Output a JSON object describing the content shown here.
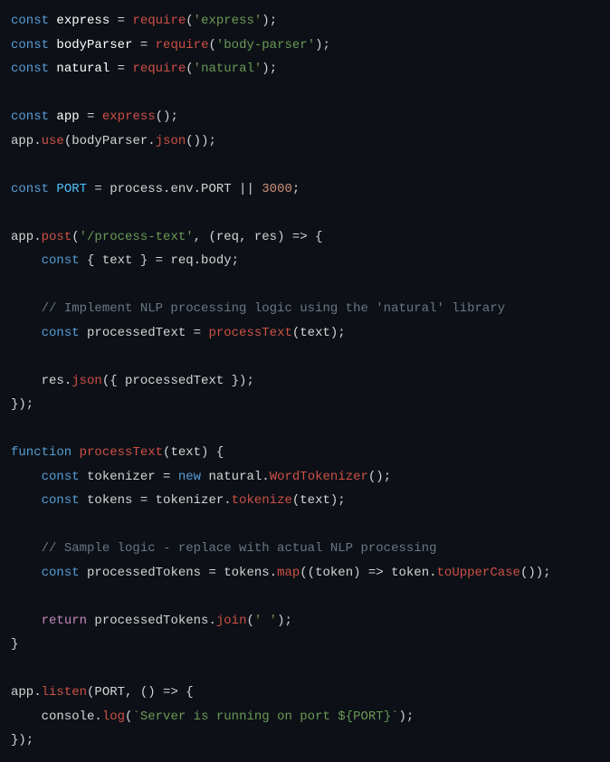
{
  "code": {
    "l1_const": "const",
    "l1_express": "express",
    "l1_eq": " = ",
    "l1_require": "require",
    "l1_open": "(",
    "l1_str": "'express'",
    "l1_close": ");",
    "l2_const": "const",
    "l2_bodyParser": "bodyParser",
    "l2_eq": " = ",
    "l2_require": "require",
    "l2_open": "(",
    "l2_str": "'body-parser'",
    "l2_close": ");",
    "l3_const": "const",
    "l3_natural": "natural",
    "l3_eq": " = ",
    "l3_require": "require",
    "l3_open": "(",
    "l3_str": "'natural'",
    "l3_close": ");",
    "l5_const": "const",
    "l5_app": "app",
    "l5_eq": " = ",
    "l5_express": "express",
    "l5_call": "();",
    "l6_app": "app.",
    "l6_use": "use",
    "l6_open": "(bodyParser.",
    "l6_json": "json",
    "l6_close": "());",
    "l8_const": "const",
    "l8_port": "PORT",
    "l8_eq": " = process.env.PORT || ",
    "l8_num": "3000",
    "l8_semi": ";",
    "l10_app": "app.",
    "l10_post": "post",
    "l10_open": "(",
    "l10_str": "'/process-text'",
    "l10_arrow": ", (req, res) => {",
    "l11_indent": "    ",
    "l11_const": "const",
    "l11_dest": " { text } = req.body;",
    "l13_indent": "    ",
    "l13_comment": "// Implement NLP processing logic using the 'natural' library",
    "l14_indent": "    ",
    "l14_const": "const",
    "l14_pt": " processedText = ",
    "l14_fn": "processText",
    "l14_args": "(text);",
    "l16_indent": "    ",
    "l16_res": "res.",
    "l16_json": "json",
    "l16_args": "({ processedText });",
    "l17_close": "});",
    "l19_function": "function",
    "l19_name": "processText",
    "l19_params": "(text) {",
    "l20_indent": "    ",
    "l20_const": "const",
    "l20_tok": " tokenizer = ",
    "l20_new": "new",
    "l20_nat": " natural.",
    "l20_wt": "WordTokenizer",
    "l20_call": "();",
    "l21_indent": "    ",
    "l21_const": "const",
    "l21_tok": " tokens = tokenizer.",
    "l21_tokenize": "tokenize",
    "l21_args": "(text);",
    "l23_indent": "    ",
    "l23_comment": "// Sample logic - replace with actual NLP processing",
    "l24_indent": "    ",
    "l24_const": "const",
    "l24_pt": " processedTokens = tokens.",
    "l24_map": "map",
    "l24_arrow": "((token) => token.",
    "l24_upper": "toUpperCase",
    "l24_close": "());",
    "l26_indent": "    ",
    "l26_return": "return",
    "l26_pt": " processedTokens.",
    "l26_join": "join",
    "l26_open": "(",
    "l26_str": "' '",
    "l26_close": ");",
    "l27_close": "}",
    "l29_app": "app.",
    "l29_listen": "listen",
    "l29_args": "(PORT, () => {",
    "l30_indent": "    ",
    "l30_console": "console.",
    "l30_log": "log",
    "l30_open": "(",
    "l30_str": "`Server is running on port ${PORT}`",
    "l30_close": ");",
    "l31_close": "});"
  }
}
